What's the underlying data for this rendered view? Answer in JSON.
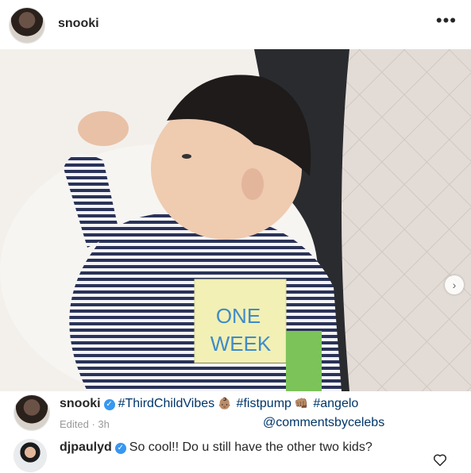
{
  "post": {
    "username": "snooki",
    "more_icon": "•••",
    "sticky_note": [
      "ONE",
      "WEEK"
    ]
  },
  "caption": {
    "username": "snooki",
    "hashtags": [
      "#ThirdChildVibes",
      "#fistpump",
      "#angelo"
    ],
    "emojis": [
      "👶🏽",
      "👊🏽"
    ],
    "edited": "Edited · 3h",
    "mention": "@commentsbycelebs"
  },
  "comment": {
    "username": "djpaulyd",
    "text": "So cool!! Do u still have the other two kids?"
  },
  "colors": {
    "verified": "#3897f0",
    "link": "#003569",
    "muted": "#999999"
  },
  "icons": {
    "next": "chevron-right-icon",
    "like": "heart-outline-icon",
    "verified": "verified-badge-icon"
  }
}
